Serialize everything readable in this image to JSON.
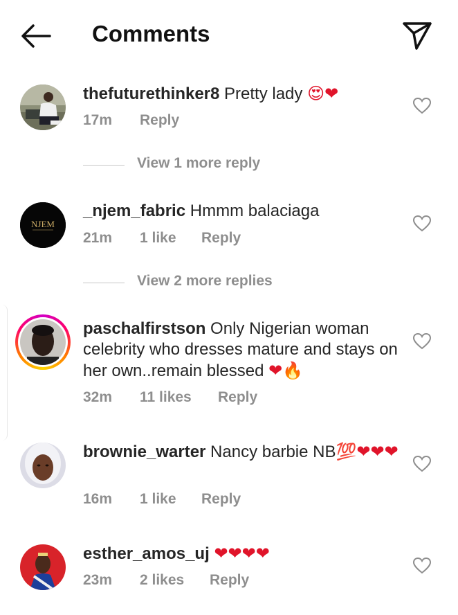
{
  "header": {
    "title": "Comments",
    "back_icon": "arrow-left-icon",
    "share_icon": "send-icon"
  },
  "comments": [
    {
      "username": "thefuturethinker8",
      "text": " Pretty lady ",
      "emoji": "😍❤",
      "time": "17m",
      "likes": "",
      "reply": "Reply",
      "view_replies": "View 1 more reply"
    },
    {
      "username": "_njem_fabric",
      "text": " Hmmm balaciaga",
      "emoji": "",
      "time": "21m",
      "likes": "1 like",
      "reply": "Reply",
      "view_replies": "View 2 more replies",
      "avatar_logo": "NJEM"
    },
    {
      "username": "paschalfirstson",
      "text": " Only Nigerian woman celebrity who dresses mature and stays on her own..remain blessed ",
      "emoji": "❤🔥",
      "time": "32m",
      "likes": "11 likes",
      "reply": "Reply",
      "view_replies": ""
    },
    {
      "username": "brownie_warter",
      "text": " Nancy barbie NB",
      "emoji": "💯❤❤❤",
      "time": "16m",
      "likes": "1 like",
      "reply": "Reply",
      "view_replies": ""
    },
    {
      "username": "esther_amos_uj",
      "text": " ",
      "emoji": "❤❤❤❤",
      "time": "23m",
      "likes": "2 likes",
      "reply": "Reply",
      "view_replies": ""
    }
  ],
  "colors": {
    "accent_red": "#e0142a",
    "meta_gray": "#8e8e8e",
    "text": "#262626"
  }
}
